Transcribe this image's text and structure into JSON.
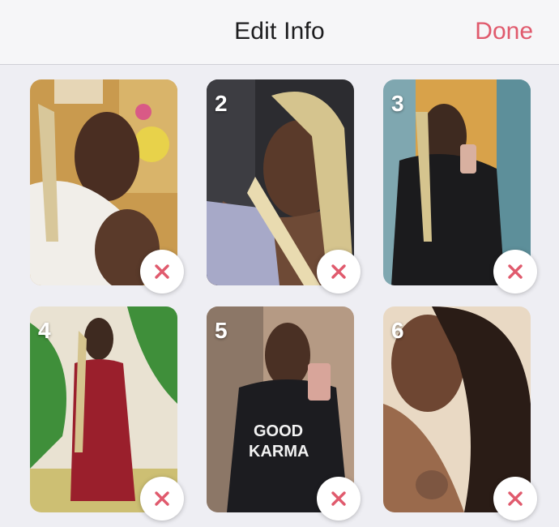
{
  "header": {
    "title": "Edit Info",
    "done_label": "Done"
  },
  "colors": {
    "accent": "#e05a6d",
    "background": "#eeeef3"
  },
  "photos": [
    {
      "number": "",
      "alt": "photo-1"
    },
    {
      "number": "2",
      "alt": "photo-2"
    },
    {
      "number": "3",
      "alt": "photo-3"
    },
    {
      "number": "4",
      "alt": "photo-4"
    },
    {
      "number": "5",
      "alt": "photo-5"
    },
    {
      "number": "6",
      "alt": "photo-6"
    }
  ],
  "icons": {
    "remove": "close-icon"
  }
}
